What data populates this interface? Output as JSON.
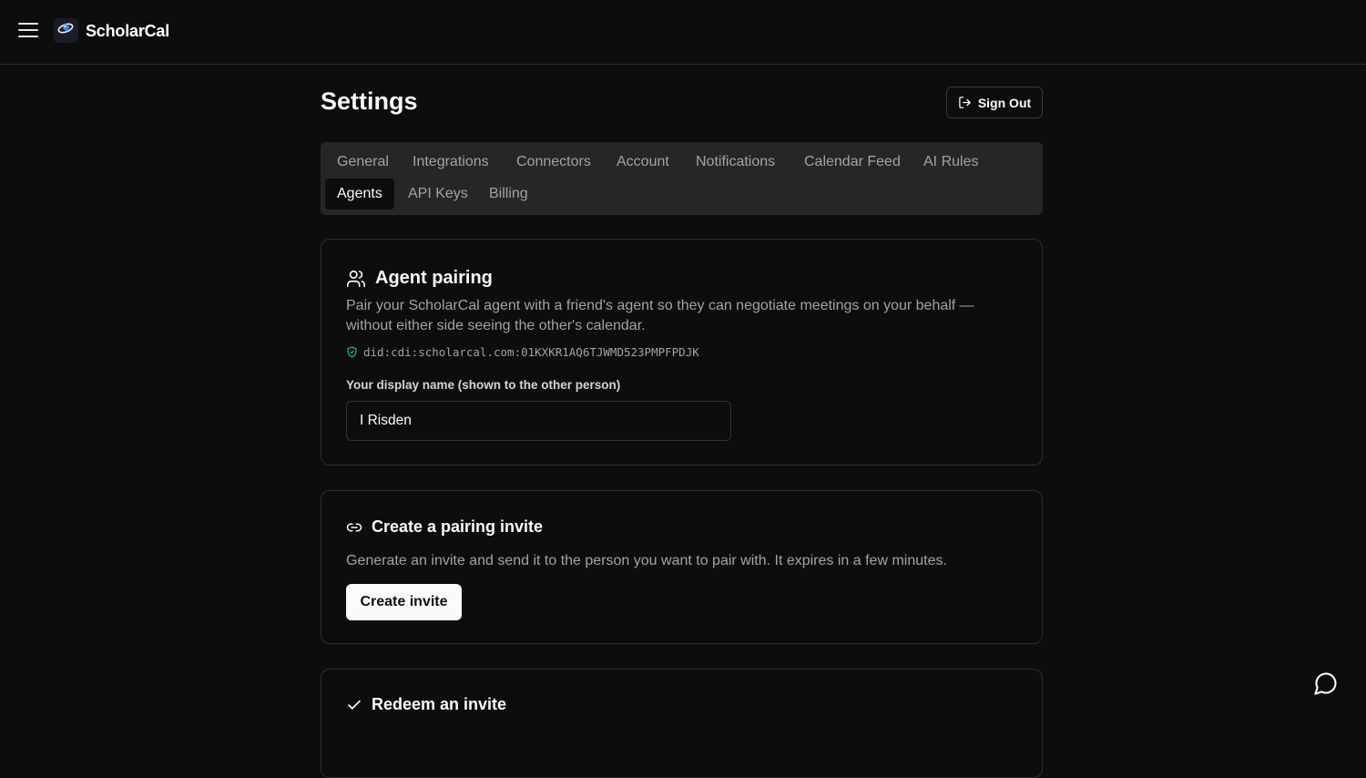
{
  "app": {
    "brand": "ScholarCal"
  },
  "header": {
    "title": "Settings",
    "sign_out_label": "Sign Out"
  },
  "tabs": [
    {
      "label": "General"
    },
    {
      "label": "Integrations"
    },
    {
      "label": "Connectors"
    },
    {
      "label": "Account"
    },
    {
      "label": "Notifications"
    },
    {
      "label": "Calendar Feed"
    },
    {
      "label": "AI Rules"
    },
    {
      "label": "Agents",
      "active": true
    },
    {
      "label": "API Keys"
    },
    {
      "label": "Billing"
    }
  ],
  "agent_pairing": {
    "title": "Agent pairing",
    "description": "Pair your ScholarCal agent with a friend's agent so they can negotiate meetings on your behalf — without either side seeing the other's calendar.",
    "did": "did:cdi:scholarcal.com:01KXKR1AQ6TJWMD523PMPFPDJK",
    "display_name_label": "Your display name (shown to the other person)",
    "display_name_value": "I Risden"
  },
  "create_invite": {
    "title": "Create a pairing invite",
    "description": "Generate an invite and send it to the person you want to pair with. It expires in a few minutes.",
    "button_label": "Create invite"
  },
  "redeem_invite": {
    "title": "Redeem an invite"
  },
  "colors": {
    "background": "#0d0d0d",
    "tab_bar": "#262626",
    "muted_text": "#a3a3a3",
    "shield_green": "#22c55e"
  },
  "icons": [
    "menu-icon",
    "app-logo",
    "sign-out-icon",
    "users-icon",
    "shield-check-icon",
    "link-icon",
    "check-icon",
    "chat-icon"
  ]
}
